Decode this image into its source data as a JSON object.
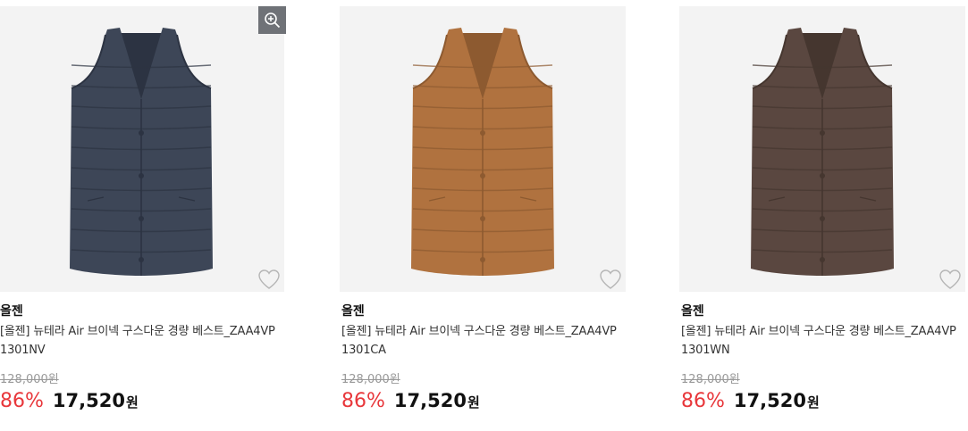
{
  "products": [
    {
      "brand": "올젠",
      "title_line1": "[올젠] 뉴테라 Air 브이넥 구스다운 경량 베스트_ZAA4VP",
      "title_line2": "1301NV",
      "original_price": "128,000원",
      "discount": "86%",
      "sale_price": "17,520",
      "currency": "원",
      "color": "#3d4657",
      "color_dark": "#2c3342",
      "has_zoom": true,
      "zoom_icon": "zoom-in-icon",
      "wish_icon": "heart-outline-icon"
    },
    {
      "brand": "올젠",
      "title_line1": "[올젠] 뉴테라 Air 브이넥 구스다운 경량 베스트_ZAA4VP",
      "title_line2": "1301CA",
      "original_price": "128,000원",
      "discount": "86%",
      "sale_price": "17,520",
      "currency": "원",
      "color": "#b0723f",
      "color_dark": "#8d5a30",
      "has_zoom": false,
      "wish_icon": "heart-outline-icon"
    },
    {
      "brand": "올젠",
      "title_line1": "[올젠] 뉴테라 Air 브이넥 구스다운 경량 베스트_ZAA4VP",
      "title_line2": "1301WN",
      "original_price": "128,000원",
      "discount": "86%",
      "sale_price": "17,520",
      "currency": "원",
      "color": "#5a4740",
      "color_dark": "#45362f",
      "has_zoom": false,
      "wish_icon": "heart-outline-icon"
    }
  ]
}
